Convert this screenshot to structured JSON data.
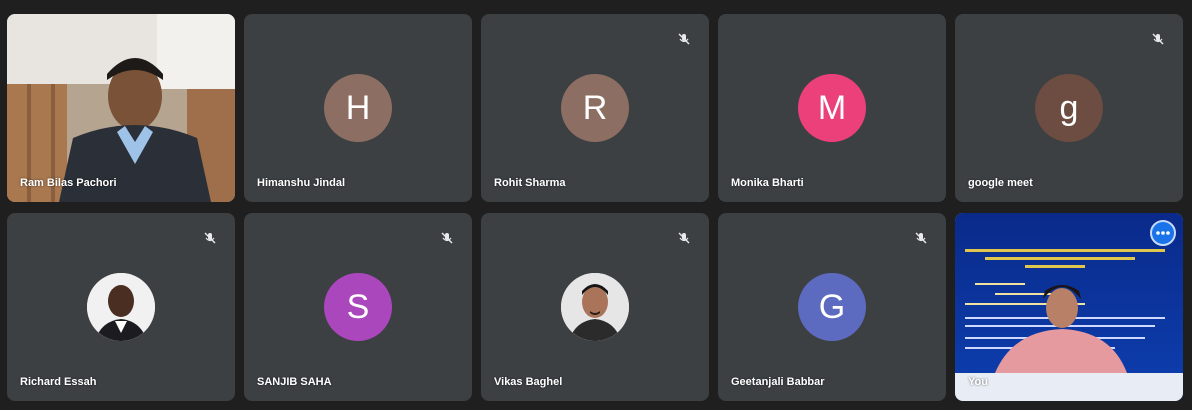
{
  "participants": [
    {
      "name": "Ram Bilas Pachori",
      "type": "video"
    },
    {
      "name": "Himanshu Jindal",
      "initial": "H",
      "avatar_color": "#8d6e63",
      "muted": false
    },
    {
      "name": "Rohit Sharma",
      "initial": "R",
      "avatar_color": "#8d6e63",
      "muted": true
    },
    {
      "name": "Monika Bharti",
      "initial": "M",
      "avatar_color": "#ec407a",
      "muted": false
    },
    {
      "name": "google meet",
      "initial": "g",
      "avatar_color": "#6d4c41",
      "muted": true
    },
    {
      "name": "Richard Essah",
      "type": "photo",
      "muted": true
    },
    {
      "name": "SANJIB SAHA",
      "initial": "S",
      "avatar_color": "#ab47bc",
      "muted": true
    },
    {
      "name": "Vikas Baghel",
      "type": "photo",
      "muted": true
    },
    {
      "name": "Geetanjali Babbar",
      "initial": "G",
      "avatar_color": "#5c6bc0",
      "muted": true
    },
    {
      "name": "You",
      "type": "video-self"
    }
  ],
  "colors": {
    "tile_bg": "#3c4043",
    "background": "#1f1f1f",
    "self_highlight": "#8ab4f8"
  },
  "icons": {
    "mute": "mic-off-icon",
    "more": "more-options-icon"
  }
}
